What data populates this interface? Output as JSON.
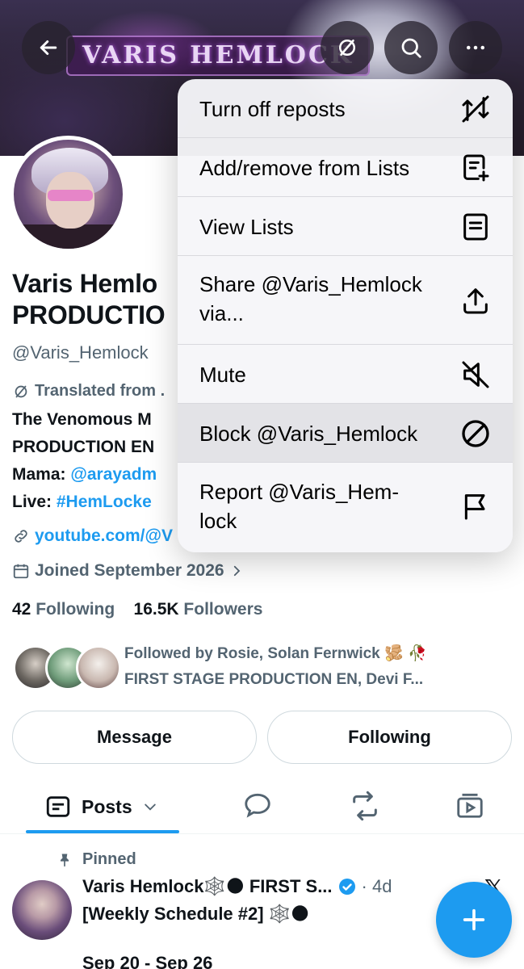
{
  "banner": {
    "logo_text": "VARIS HEMLOCK"
  },
  "profile": {
    "name_line1": "Varis Hemlo",
    "name_line2": "PRODUCTIO",
    "handle": "@Varis_Hemlock",
    "translated": "Translated from .",
    "bio_line1": "The Venomous M",
    "bio_line2": "PRODUCTION EN",
    "bio_line3_label": "Mama: ",
    "bio_line3_link": "@arayadm",
    "bio_line4_label": "Live: ",
    "bio_line4_link": "#HemLocke",
    "link": "youtube.com/@V",
    "joined": "Joined September 2026",
    "following_count": "42",
    "following_label": "Following",
    "followers_count": "16.5K",
    "followers_label": "Followers",
    "followed_by_line1": "Followed by Rosie, Solan Fernwick 🫚 🥀",
    "followed_by_line2": "FIRST STAGE PRODUCTION EN, Devi F..."
  },
  "actions": {
    "message": "Message",
    "following": "Following"
  },
  "tabs": {
    "posts": "Posts"
  },
  "post": {
    "pinned": "Pinned",
    "author": "Varis Hemlock🕸️🌑 FIRST S...",
    "time": "· 4d",
    "line1": "[Weekly Schedule #2] 🕸️🌑",
    "line2": "Sep 20 - Sep 26"
  },
  "menu": {
    "items": [
      {
        "label": "Turn off reposts",
        "icon": "repost-off-icon"
      },
      {
        "label": "Add/remove from Lists",
        "icon": "list-add-icon"
      },
      {
        "label": "View Lists",
        "icon": "list-icon"
      },
      {
        "label_line1": "Share @Varis_Hemlock",
        "label_line2": "via...",
        "icon": "share-icon"
      },
      {
        "label": "Mute",
        "icon": "mute-icon"
      },
      {
        "label": "Block @Varis_Hemlock",
        "icon": "block-icon"
      },
      {
        "label_line1": "Report @Varis_Hem-",
        "label_line2": "lock",
        "icon": "flag-icon"
      }
    ]
  },
  "colors": {
    "accent": "#1d9bf0",
    "text": "#0f1419",
    "muted": "#536471"
  }
}
